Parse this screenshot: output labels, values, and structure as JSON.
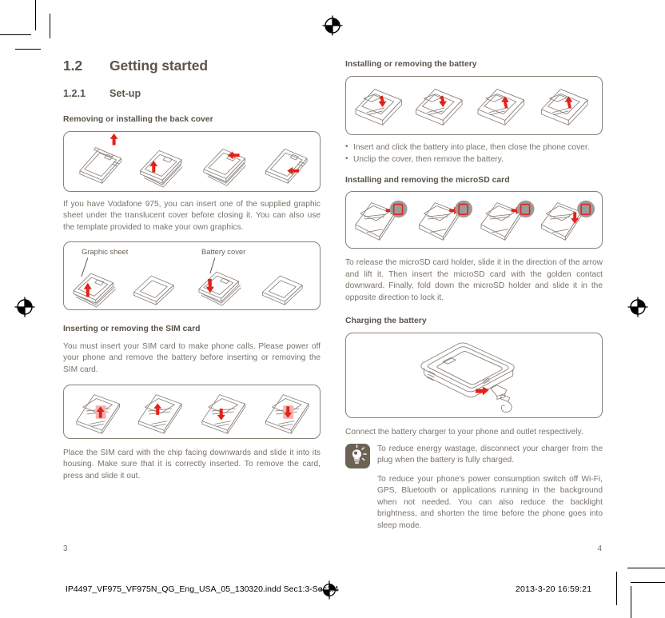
{
  "document": {
    "language": "en-US",
    "left_column": {
      "section": {
        "number": "1.2",
        "title": "Getting started"
      },
      "subsection": {
        "number": "1.2.1",
        "title": "Set-up"
      },
      "blocks": [
        {
          "heading": "Removing or installing the back cover",
          "figure": {
            "name": "back-cover-steps",
            "steps": 4,
            "labels": []
          },
          "paragraph": "If you have Vodafone 975, you can insert one of the supplied graphic sheet under the translucent cover before closing it. You can also use the template provided to make your own graphics."
        },
        {
          "heading": "",
          "figure": {
            "name": "graphic-sheet-steps",
            "steps": 4,
            "labels": [
              "Graphic sheet",
              "Battery cover"
            ]
          }
        },
        {
          "heading": "Inserting or removing the SIM card",
          "paragraph": "You must insert your SIM card to make phone calls. Please power off your phone and remove the battery before inserting or removing the SIM card.",
          "figure": {
            "name": "sim-card-steps",
            "steps": 4,
            "labels": []
          },
          "paragraph_after": "Place the SIM card with the chip facing downwards and slide it into its housing. Make sure that it is correctly inserted. To remove the card, press and slide it out."
        }
      ]
    },
    "right_column": {
      "blocks": [
        {
          "heading": "Installing or removing the battery",
          "figure": {
            "name": "battery-steps",
            "steps": 4,
            "labels": []
          },
          "bullets": [
            "Insert and click the battery into place, then close the phone cover.",
            "Unclip the cover, then remove the battery."
          ]
        },
        {
          "heading": "Installing and removing the microSD card",
          "figure": {
            "name": "microsd-steps",
            "steps": 4,
            "labels": []
          },
          "paragraph": "To release the microSD card holder, slide it in the direction of the arrow and lift it. Then insert the microSD card with the golden contact downward. Finally, fold down the microSD holder and slide it in the opposite direction to lock it."
        },
        {
          "heading": "Charging the battery",
          "figure": {
            "name": "charging-illustration",
            "steps": 1,
            "labels": []
          },
          "paragraph": "Connect the battery charger to your phone and outlet respectively."
        }
      ],
      "tip": {
        "icon": "lightbulb-icon",
        "paragraphs": [
          "To reduce energy wastage, disconnect your charger from the plug when the battery is fully charged.",
          "To reduce your phone's power consumption switch off Wi-Fi, GPS, Bluetooth or applications running in the background when not needed. You can also reduce the backlight brightness, and shorten the time before the phone goes into sleep mode."
        ]
      }
    },
    "folios": {
      "left": "3",
      "right": "4"
    },
    "imprint": {
      "file": "IP4497_VF975_VF975N_QG_Eng_USA_05_130320.indd   Sec1:3-Sec1:4",
      "date": "2013-3-20   16:59:21"
    }
  },
  "colors": {
    "heading": "#5c544a",
    "body_text": "#7a736a",
    "frame_stroke": "#8a8177",
    "arrow_red": "#e2231a",
    "device_outline": "#8a817a",
    "tip_icon_bg": "#6c6355"
  }
}
